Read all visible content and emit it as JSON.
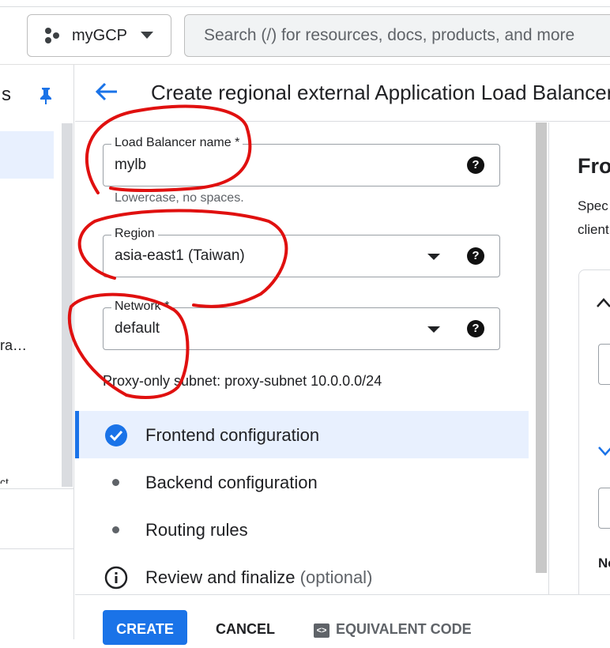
{
  "header": {
    "project_name": "myGCP",
    "search_placeholder": "Search (/) for resources, docs, products, and more"
  },
  "leftnav": {
    "truncated_title": "s",
    "truncated_item": "ra…",
    "truncated_item2": "ct"
  },
  "page": {
    "title": "Create regional external Application Load Balancer"
  },
  "form": {
    "name_label": "Load Balancer name *",
    "name_value": "mylb",
    "name_hint": "Lowercase, no spaces.",
    "region_label": "Region",
    "region_value": "asia-east1 (Taiwan)",
    "network_label": "Network *",
    "network_value": "default",
    "proxy_subnet_text": "Proxy-only subnet: proxy-subnet 10.0.0.0/24",
    "help_glyph": "?"
  },
  "steps": [
    {
      "label": "Frontend configuration",
      "state": "done"
    },
    {
      "label": "Backend configuration",
      "state": "pending"
    },
    {
      "label": "Routing rules",
      "state": "pending"
    },
    {
      "label": "Review and finalize",
      "optional": "(optional)",
      "state": "info"
    }
  ],
  "right_panel": {
    "heading": "Fro",
    "line1": "Spec",
    "line2": "client",
    "ne": "Ne"
  },
  "actions": {
    "create": "CREATE",
    "cancel": "CANCEL",
    "equivalent_code": "EQUIVALENT CODE",
    "code_icon_glyph": "<>"
  },
  "colors": {
    "accent": "#1a73e8",
    "annotation": "#e0100f"
  }
}
